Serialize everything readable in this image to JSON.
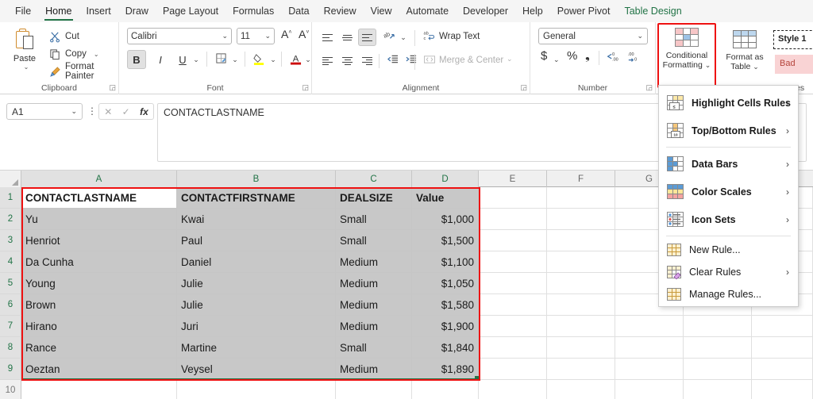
{
  "tabs": [
    {
      "label": "File",
      "state": "normal"
    },
    {
      "label": "Home",
      "state": "active"
    },
    {
      "label": "Insert",
      "state": "normal"
    },
    {
      "label": "Draw",
      "state": "normal"
    },
    {
      "label": "Page Layout",
      "state": "normal"
    },
    {
      "label": "Formulas",
      "state": "normal"
    },
    {
      "label": "Data",
      "state": "normal"
    },
    {
      "label": "Review",
      "state": "normal"
    },
    {
      "label": "View",
      "state": "normal"
    },
    {
      "label": "Automate",
      "state": "normal"
    },
    {
      "label": "Developer",
      "state": "normal"
    },
    {
      "label": "Help",
      "state": "normal"
    },
    {
      "label": "Power Pivot",
      "state": "normal"
    },
    {
      "label": "Table Design",
      "state": "contextual"
    }
  ],
  "ribbon": {
    "clipboard": {
      "group_label": "Clipboard",
      "paste_label": "Paste",
      "cut_label": "Cut",
      "copy_label": "Copy",
      "format_painter_label": "Format Painter"
    },
    "font": {
      "group_label": "Font",
      "font_name": "Calibri",
      "font_size": "11",
      "grow_font": "A",
      "shrink_font": "A",
      "bold": "B",
      "italic": "I",
      "underline": "U"
    },
    "alignment": {
      "group_label": "Alignment",
      "wrap_text_label": "Wrap Text",
      "merge_center_label": "Merge & Center"
    },
    "number": {
      "group_label": "Number",
      "format": "General",
      "accounting": "$",
      "percent": "%",
      "comma": ",",
      "increase_decimal": ".00",
      "decrease_decimal": ".00"
    },
    "styles": {
      "group_label": "es",
      "conditional_formatting_line1": "Conditional",
      "conditional_formatting_line2": "Formatting",
      "format_as_table_line1": "Format as",
      "format_as_table_line2": "Table",
      "style_1": "Style 1",
      "bad": "Bad",
      "highlight_color": "#ee1111"
    }
  },
  "formula_bar": {
    "name_box": "A1",
    "cancel": "✕",
    "enter": "✓",
    "insert_function": "fx",
    "content": "CONTACTLASTNAME"
  },
  "cf_menu": {
    "items": [
      {
        "label": "Highlight Cells Rules",
        "accel": "H",
        "has_arrow": true,
        "icon": "highlight-cells-rules-icon",
        "size": "large"
      },
      {
        "label": "Top/Bottom Rules",
        "accel": "T",
        "has_arrow": true,
        "icon": "top-bottom-rules-icon",
        "size": "large"
      },
      {
        "separator": true
      },
      {
        "label": "Data Bars",
        "accel": "D",
        "has_arrow": true,
        "icon": "data-bars-icon",
        "size": "large"
      },
      {
        "label": "Color Scales",
        "accel": "S",
        "has_arrow": true,
        "icon": "color-scales-icon",
        "size": "large"
      },
      {
        "label": "Icon Sets",
        "accel": "I",
        "has_arrow": true,
        "icon": "icon-sets-icon",
        "size": "large"
      },
      {
        "separator": true
      },
      {
        "label": "New Rule...",
        "accel": "N",
        "has_arrow": false,
        "icon": "new-rule-icon",
        "size": "small"
      },
      {
        "label": "Clear Rules",
        "accel": "C",
        "has_arrow": true,
        "icon": "clear-rules-icon",
        "size": "small"
      },
      {
        "label": "Manage Rules...",
        "accel": "R",
        "has_arrow": false,
        "icon": "manage-rules-icon",
        "size": "small"
      }
    ]
  },
  "sheet": {
    "columns": [
      "A",
      "B",
      "C",
      "D",
      "E",
      "F",
      "G"
    ],
    "selected_columns": [
      "A",
      "B",
      "C",
      "D"
    ],
    "rows": [
      "1",
      "2",
      "3",
      "4",
      "5",
      "6",
      "7",
      "8",
      "9",
      "10"
    ],
    "selected_rows": [
      "1",
      "2",
      "3",
      "4",
      "5",
      "6",
      "7",
      "8",
      "9"
    ],
    "active_cell": "A1",
    "selection_range": "A1:D9",
    "headers": [
      "CONTACTLASTNAME",
      "CONTACTFIRSTNAME",
      "DEALSIZE",
      "Value"
    ],
    "data": [
      [
        "Yu",
        "Kwai",
        "Small",
        "$1,000"
      ],
      [
        "Henriot",
        "Paul",
        "Small",
        "$1,500"
      ],
      [
        "Da Cunha",
        "Daniel",
        "Medium",
        "$1,100"
      ],
      [
        "Young",
        "Julie",
        "Medium",
        "$1,050"
      ],
      [
        "Brown",
        "Julie",
        "Medium",
        "$1,580"
      ],
      [
        "Hirano",
        "Juri",
        "Medium",
        "$1,900"
      ],
      [
        "Rance",
        "Martine",
        "Small",
        "$1,840"
      ],
      [
        "Oeztan",
        "Veysel",
        "Medium",
        "$1,890"
      ]
    ]
  }
}
